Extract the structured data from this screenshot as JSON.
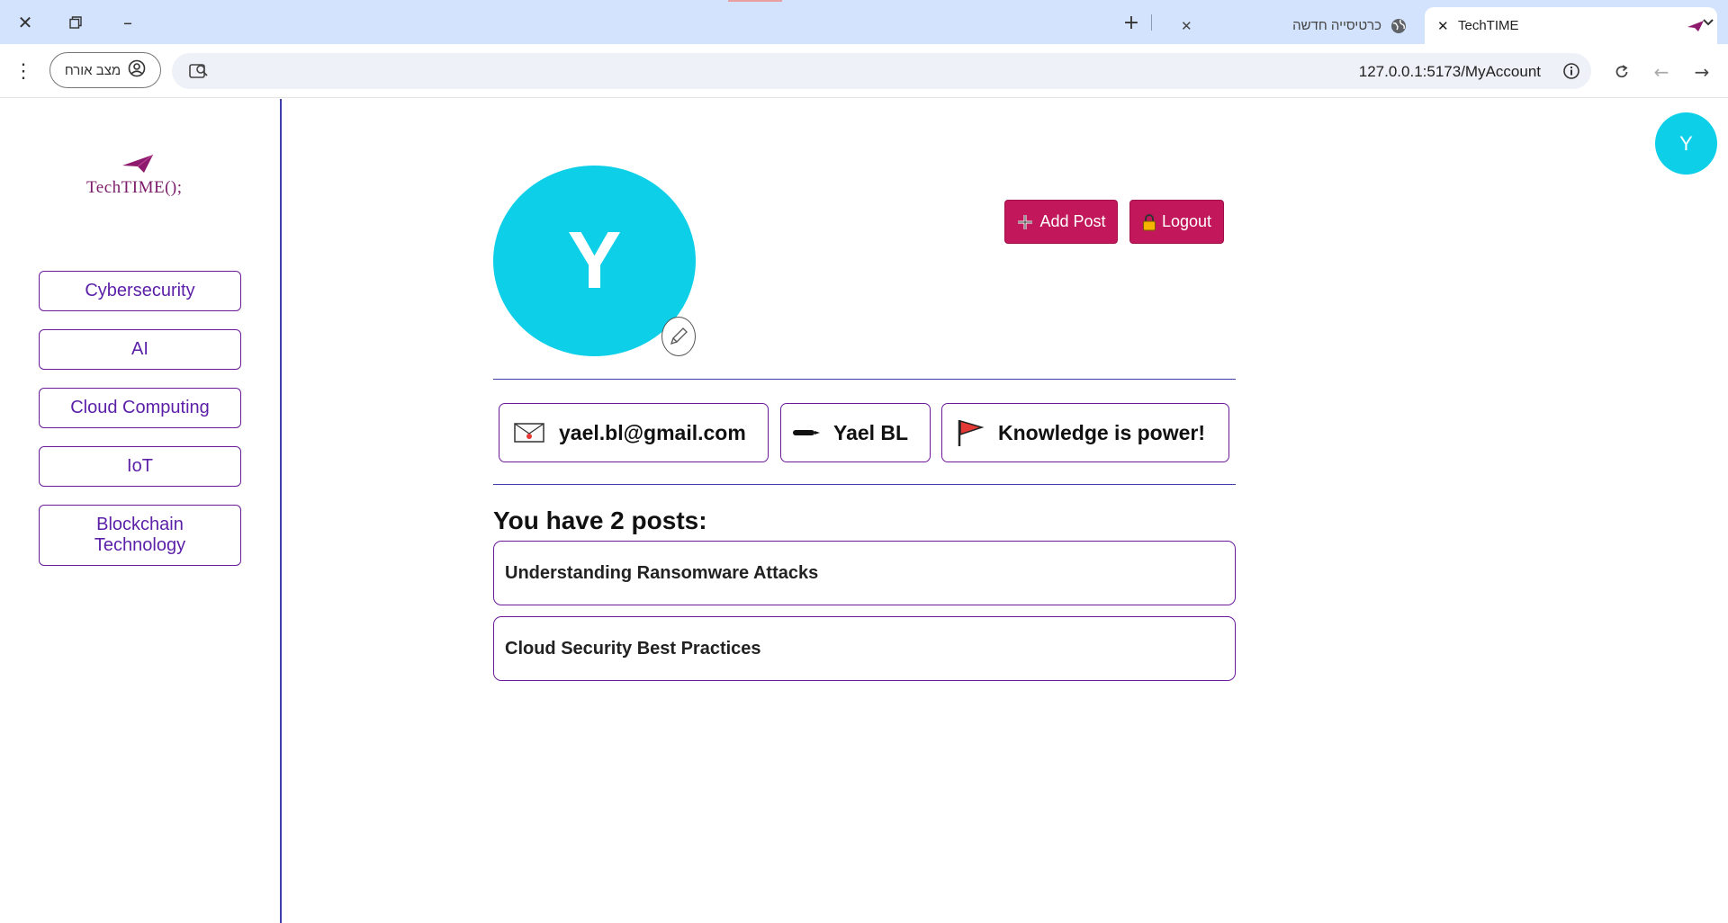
{
  "browser": {
    "tabs": [
      {
        "label": "TechTIME",
        "active": true
      },
      {
        "label": "כרטיסייה חדשה",
        "active": false
      }
    ],
    "url": "127.0.0.1:5173/MyAccount",
    "guest_label": "מצב אורח"
  },
  "site": {
    "logo_text": "TechTIME();",
    "categories": [
      "Cybersecurity",
      "AI",
      "Cloud Computing",
      "IoT",
      "Blockchain Technology"
    ],
    "user_initial": "Y"
  },
  "profile": {
    "initial": "Y",
    "add_post_label": "Add Post",
    "logout_label": "Logout",
    "email": "yael.bl@gmail.com",
    "name": "Yael BL",
    "motto": "Knowledge is power!"
  },
  "posts": {
    "title": "You have 2 posts:",
    "items": [
      "Understanding Ransomware Attacks",
      "Cloud Security Best Practices"
    ]
  },
  "colors": {
    "accent": "#c2185b",
    "avatar": "#0dcfe8",
    "border": "#6a1b9a",
    "sidebar_line": "#3f3fa8"
  }
}
